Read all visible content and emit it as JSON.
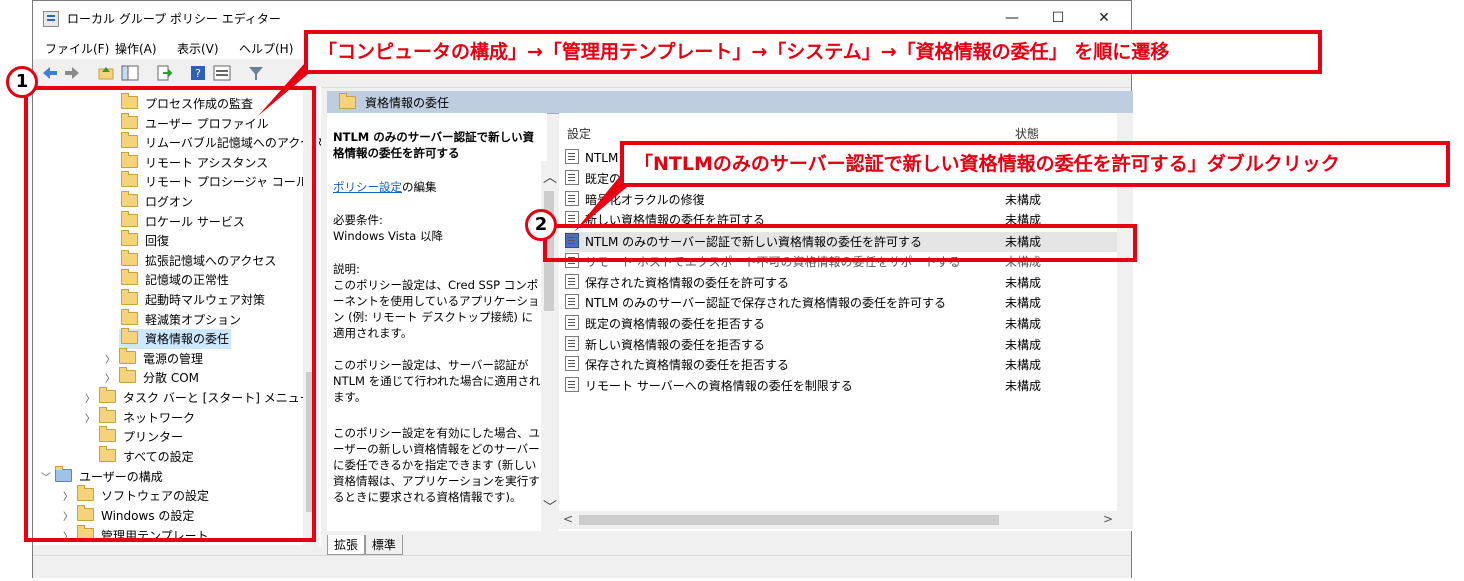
{
  "window": {
    "title": "ローカル グループ ポリシー エディター",
    "controls": {
      "minimize": "—",
      "maximize": "☐",
      "close": "✕"
    }
  },
  "menu": [
    "ファイル(F)",
    "操作(A)",
    "表示(V)",
    "ヘルプ(H)"
  ],
  "tree": {
    "items": [
      "プロセス作成の監査",
      "ユーザー プロファイル",
      "リムーバブル記憶域へのアクセス",
      "リモート アシスタンス",
      "リモート プロシージャ コール",
      "ログオン",
      "ロケール サービス",
      "回復",
      "拡張記憶域へのアクセス",
      "記憶域の正常性",
      "起動時マルウェア対策",
      "軽減策オプション",
      "資格情報の委任",
      "電源の管理",
      "分散 COM",
      "タスク バーと [スタート] メニュー",
      "ネットワーク",
      "プリンター",
      "すべての設定",
      "ユーザーの構成",
      "ソフトウェアの設定",
      "Windows の設定",
      "管理用テンプレート"
    ],
    "selected": "資格情報の委任"
  },
  "right_header": "資格情報の委任",
  "description": {
    "title": "NTLM のみのサーバー認証で新しい資格情報の委任を許可する",
    "edit_link": "ポリシー設定",
    "edit_suffix": "の編集",
    "requirement": "必要条件:\nWindows Vista 以降",
    "explanation_1": "説明:\nこのポリシー設定は、Cred SSP コンポーネントを使用しているアプリケーション (例: リモート デスクトップ接続) に適用されます。",
    "explanation_2": "このポリシー設定は、サーバー認証が NTLM を通じて行われた場合に適用されます。",
    "explanation_3": "このポリシー設定を有効にした場合、ユーザーの新しい資格情報をどのサーバーに委任できるかを指定できます (新しい資格情報は、アプリケーションを実行するときに要求される資格情報です)。"
  },
  "list": {
    "col_setting": "設定",
    "col_state": "状態",
    "rows": [
      {
        "name": "NTLM",
        "state": ""
      },
      {
        "name": "既定の",
        "state": ""
      },
      {
        "name": "暗号化オラクルの修復",
        "state": "未構成"
      },
      {
        "name": "新しい資格情報の委任を許可する",
        "state": "未構成"
      },
      {
        "name": "NTLM のみのサーバー認証で新しい資格情報の委任を許可する",
        "state": "未構成"
      },
      {
        "name": "リモート ホストでエクスポート不可の資格情報の委任をサポートする",
        "state": "未構成"
      },
      {
        "name": "保存された資格情報の委任を許可する",
        "state": "未構成"
      },
      {
        "name": "NTLM のみのサーバー認証で保存された資格情報の委任を許可する",
        "state": "未構成"
      },
      {
        "name": "既定の資格情報の委任を拒否する",
        "state": "未構成"
      },
      {
        "name": "新しい資格情報の委任を拒否する",
        "state": "未構成"
      },
      {
        "name": "保存された資格情報の委任を拒否する",
        "state": "未構成"
      },
      {
        "name": "リモート サーバーへの資格情報の委任を制限する",
        "state": "未構成"
      }
    ]
  },
  "tabs": [
    "拡張",
    "標準"
  ],
  "annotations": {
    "step1_number": "1",
    "step1_text": "「コンピュータの構成」→「管理用テンプレート」→「システム」→「資格情報の委任」 を順に遷移",
    "step2_number": "2",
    "step2_text": "「NTLMのみのサーバー認証で新しい資格情報の委任を許可する」ダブルクリック",
    "accent_color": "#e60012"
  }
}
